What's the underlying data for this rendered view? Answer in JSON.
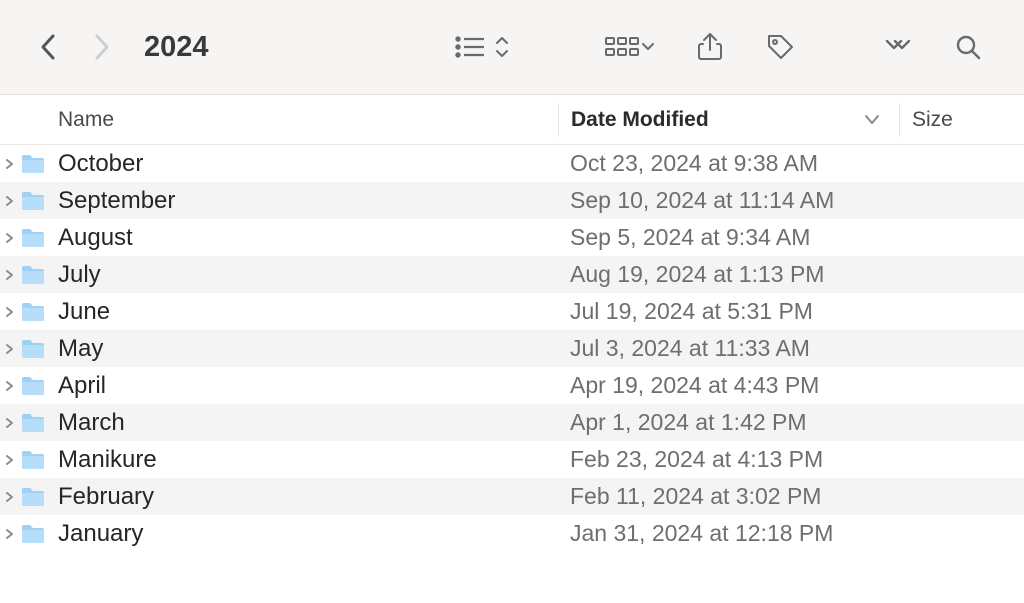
{
  "toolbar": {
    "title": "2024"
  },
  "columns": {
    "name": "Name",
    "date_modified": "Date Modified",
    "size": "Size"
  },
  "rows": [
    {
      "icon": "folder",
      "name": "October",
      "date_modified": "Oct 23, 2024 at 9:38 AM",
      "size": ""
    },
    {
      "icon": "folder",
      "name": "September",
      "date_modified": "Sep 10, 2024 at 11:14 AM",
      "size": ""
    },
    {
      "icon": "folder",
      "name": "August",
      "date_modified": "Sep 5, 2024 at 9:34 AM",
      "size": ""
    },
    {
      "icon": "folder",
      "name": "July",
      "date_modified": "Aug 19, 2024 at 1:13 PM",
      "size": ""
    },
    {
      "icon": "folder",
      "name": "June",
      "date_modified": "Jul 19, 2024 at 5:31 PM",
      "size": ""
    },
    {
      "icon": "folder",
      "name": "May",
      "date_modified": "Jul 3, 2024 at 11:33 AM",
      "size": ""
    },
    {
      "icon": "folder",
      "name": "April",
      "date_modified": "Apr 19, 2024 at 4:43 PM",
      "size": ""
    },
    {
      "icon": "folder",
      "name": "March",
      "date_modified": "Apr 1, 2024 at 1:42 PM",
      "size": ""
    },
    {
      "icon": "folder",
      "name": "Manikure",
      "date_modified": "Feb 23, 2024 at 4:13 PM",
      "size": ""
    },
    {
      "icon": "folder",
      "name": "February",
      "date_modified": "Feb 11, 2024 at 3:02 PM",
      "size": ""
    },
    {
      "icon": "folder",
      "name": "January",
      "date_modified": "Jan 31, 2024 at 12:18 PM",
      "size": ""
    }
  ]
}
